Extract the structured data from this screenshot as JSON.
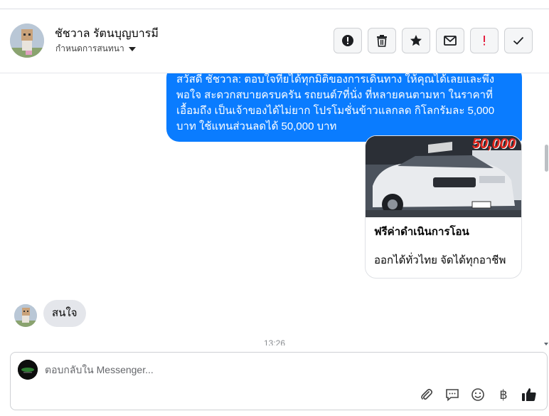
{
  "header": {
    "contact_name": "ชัชวาล รัตนบุญบารมี",
    "conversation_settings": "กำหนดการสนทนา"
  },
  "actions": [
    {
      "name": "report-button",
      "icon": "exclamation-circle-icon"
    },
    {
      "name": "delete-button",
      "icon": "trash-icon"
    },
    {
      "name": "star-button",
      "icon": "star-icon"
    },
    {
      "name": "mark-unread-button",
      "icon": "envelope-icon"
    },
    {
      "name": "follow-up-button",
      "icon": "exclamation-icon",
      "color": "#e41e3f"
    },
    {
      "name": "mark-done-button",
      "icon": "check-icon"
    }
  ],
  "thread": {
    "outgoing_message": "สวัสดี ชัชวาล: ตอบใจที่ยได้ทุกมิติของการเดินทาง ให้คุณได้เลยและพึงพอใจ สะดวกสบายครบครัน รถยนต์7ที่นั่ง ที่หลายคนตามหา ในราคาที่เอื้อมถึง เป็นเจ้าของได้ไม่ยาก โปรโมชั่นข้าวแลกลด กิโลกรัมละ 5,000 บาท ใช้แทนส่วนลดได้ 50,000 บาท",
    "card": {
      "image_banner": "50,000",
      "title": "ฟรีค่าดำเนินการโอน",
      "subtitle": "ออกได้ทั่วไทย จัดได้ทุกอาชีพ"
    },
    "incoming_message": "สนใจ",
    "timestamp": "13:26"
  },
  "composer": {
    "placeholder": "ตอบกลับใน Messenger...",
    "tools": [
      "paperclip-icon",
      "saved-replies-icon",
      "emoji-icon",
      "baht-icon",
      "thumbs-up-icon"
    ]
  },
  "colors": {
    "outgoing_bubble": "#0a7cff",
    "incoming_bubble": "#e4e6eb",
    "follow_up": "#e41e3f"
  }
}
